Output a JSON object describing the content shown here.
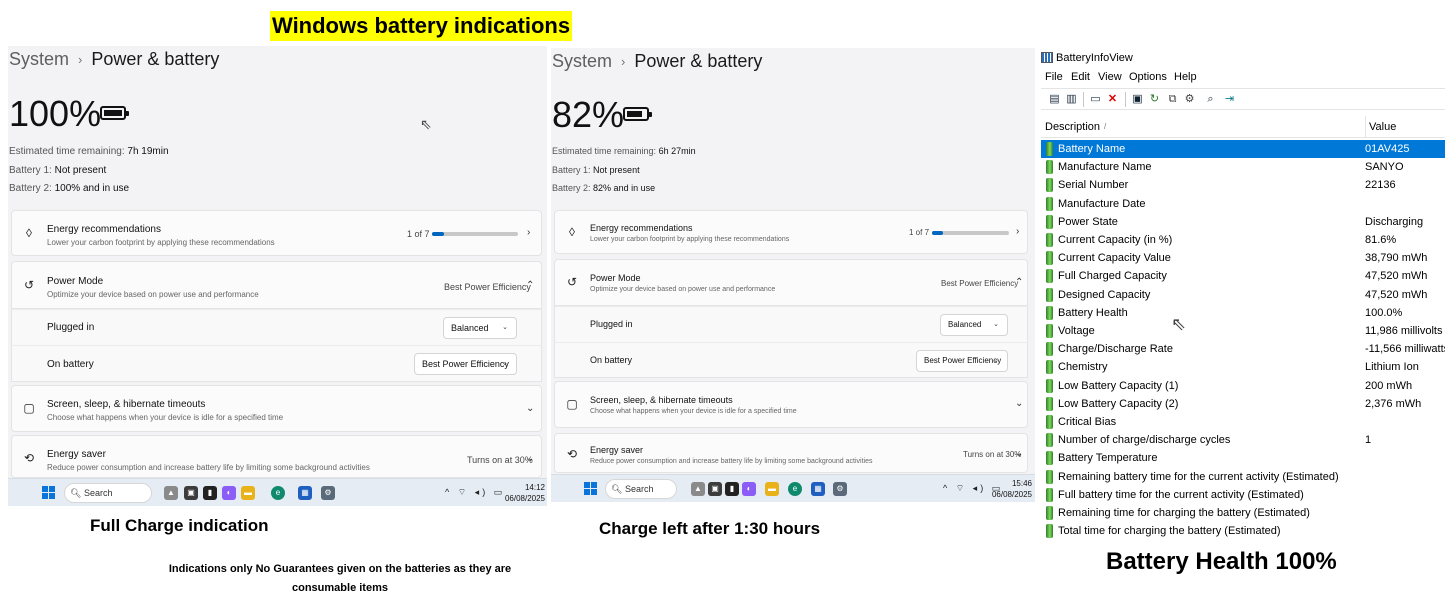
{
  "heading": "Windows battery indications",
  "panels": [
    {
      "breadcrumb_parent": "System",
      "breadcrumb_chevron": "›",
      "page_title": "Power & battery",
      "percent": "100%",
      "battery_level": 1.0,
      "time_label": "Estimated time remaining:",
      "time_value": "7h 19min",
      "battery1_label": "Battery 1:",
      "battery1_value": "Not present",
      "battery2_label": "Battery 2:",
      "battery2_value": "100% and in use",
      "energy_rec": {
        "title": "Energy recommendations",
        "desc": "Lower your carbon footprint by applying these recommendations",
        "count": "1 of 7",
        "progress": 0.14
      },
      "power_mode": {
        "title": "Power Mode",
        "desc": "Optimize your device based on power use and performance",
        "value": "Best Power Efficiency"
      },
      "plugged_in": {
        "label": "Plugged in",
        "value": "Balanced"
      },
      "on_battery": {
        "label": "On battery",
        "value": "Best Power Efficiency"
      },
      "screen_sleep": {
        "title": "Screen, sleep, & hibernate timeouts",
        "desc": "Choose what happens when your device is idle for a specified time"
      },
      "energy_saver": {
        "title": "Energy saver",
        "desc": "Reduce power consumption and increase battery life by limiting some background activities",
        "value": "Turns on at 30%"
      },
      "taskbar": {
        "search": "Search",
        "time": "14:12",
        "date": "06/08/2025"
      }
    },
    {
      "breadcrumb_parent": "System",
      "breadcrumb_chevron": "›",
      "page_title": "Power & battery",
      "percent": "82%",
      "battery_level": 0.82,
      "time_label": "Estimated time remaining:",
      "time_value": "6h 27min",
      "battery1_label": "Battery 1:",
      "battery1_value": "Not present",
      "battery2_label": "Battery 2:",
      "battery2_value": "82% and in use",
      "energy_rec": {
        "title": "Energy recommendations",
        "desc": "Lower your carbon footprint by applying these recommendations",
        "count": "1 of 7",
        "progress": 0.14
      },
      "power_mode": {
        "title": "Power Mode",
        "desc": "Optimize your device based on power use and performance",
        "value": "Best Power Efficiency"
      },
      "plugged_in": {
        "label": "Plugged in",
        "value": "Balanced"
      },
      "on_battery": {
        "label": "On battery",
        "value": "Best Power Efficiency"
      },
      "screen_sleep": {
        "title": "Screen, sleep, & hibernate timeouts",
        "desc": "Choose what happens when your device is idle for a specified time"
      },
      "energy_saver": {
        "title": "Energy saver",
        "desc": "Reduce power consumption and increase battery life by limiting some background activities",
        "value": "Turns on at 30%"
      },
      "taskbar": {
        "search": "Search",
        "time": "15:46",
        "date": "06/08/2025"
      }
    }
  ],
  "captions": {
    "full_charge": "Full Charge indication",
    "disclaimer_line1": "Indications only No Guarantees given on the batteries as they are",
    "disclaimer_line2": "consumable items",
    "charge_left": "Charge left after 1:30 hours",
    "battery_health": "Battery Health 100%"
  },
  "batteryinfoview": {
    "title": "BatteryInfoView",
    "menu": [
      "File",
      "Edit",
      "View",
      "Options",
      "Help"
    ],
    "toolbar_icons": [
      "properties-icon",
      "copy-icon",
      "html-report-icon",
      "delete-icon",
      "save-icon",
      "refresh-icon",
      "copy-clipboard-icon",
      "options-icon",
      "find-icon",
      "exit-icon"
    ],
    "columns": {
      "description": "Description",
      "sort_indicator": "/",
      "value": "Value"
    },
    "rows": [
      {
        "description": "Battery Name",
        "value": "01AV425"
      },
      {
        "description": "Manufacture Name",
        "value": "SANYO"
      },
      {
        "description": "Serial Number",
        "value": "22136"
      },
      {
        "description": "Manufacture Date",
        "value": ""
      },
      {
        "description": "Power State",
        "value": "Discharging"
      },
      {
        "description": "Current Capacity (in %)",
        "value": "81.6%"
      },
      {
        "description": "Current Capacity Value",
        "value": "38,790 mWh"
      },
      {
        "description": "Full Charged Capacity",
        "value": "47,520 mWh"
      },
      {
        "description": "Designed Capacity",
        "value": "47,520 mWh"
      },
      {
        "description": "Battery Health",
        "value": "100.0%"
      },
      {
        "description": "Voltage",
        "value": "11,986 millivolts"
      },
      {
        "description": "Charge/Discharge Rate",
        "value": "-11,566 milliwatts"
      },
      {
        "description": "Chemistry",
        "value": "Lithium Ion"
      },
      {
        "description": "Low Battery Capacity (1)",
        "value": "200 mWh"
      },
      {
        "description": "Low Battery Capacity (2)",
        "value": "2,376 mWh"
      },
      {
        "description": "Critical Bias",
        "value": ""
      },
      {
        "description": "Number of charge/discharge cycles",
        "value": "1"
      },
      {
        "description": "Battery Temperature",
        "value": ""
      },
      {
        "description": "Remaining battery time for the current activity (Estimated)",
        "value": ""
      },
      {
        "description": "Full battery time for the current activity (Estimated)",
        "value": ""
      },
      {
        "description": "Remaining time for charging the battery (Estimated)",
        "value": ""
      },
      {
        "description": "Total  time for charging the battery (Estimated)",
        "value": ""
      }
    ],
    "selected_row": 0
  },
  "colors": {
    "highlight": "#ffff00",
    "accent": "#0067c0",
    "selection": "#0078d7"
  }
}
